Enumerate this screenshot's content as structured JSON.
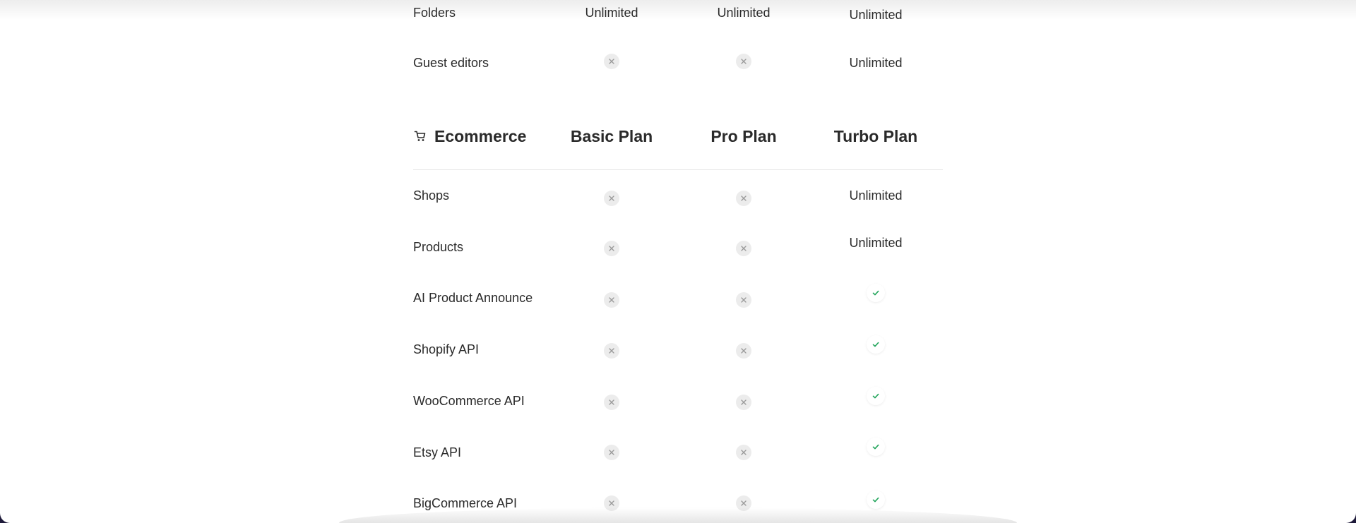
{
  "top_rows": [
    {
      "feature": "Folders",
      "basic": "Unlimited",
      "pro": "Unlimited",
      "turbo": "Unlimited"
    },
    {
      "feature": "Guest editors",
      "basic": "x",
      "pro": "x",
      "turbo": "Unlimited"
    }
  ],
  "ecommerce": {
    "title": "Ecommerce",
    "icon": "shopping-cart-icon",
    "plans": [
      "Basic Plan",
      "Pro Plan",
      "Turbo Plan"
    ],
    "rows": [
      {
        "feature": "Shops",
        "basic": "x",
        "pro": "x",
        "turbo": "Unlimited"
      },
      {
        "feature": "Products",
        "basic": "x",
        "pro": "x",
        "turbo": "Unlimited"
      },
      {
        "feature": "AI Product Announce",
        "basic": "x",
        "pro": "x",
        "turbo": "check"
      },
      {
        "feature": "Shopify API",
        "basic": "x",
        "pro": "x",
        "turbo": "check"
      },
      {
        "feature": "WooCommerce API",
        "basic": "x",
        "pro": "x",
        "turbo": "check"
      },
      {
        "feature": "Etsy API",
        "basic": "x",
        "pro": "x",
        "turbo": "check"
      },
      {
        "feature": "BigCommerce API",
        "basic": "x",
        "pro": "x",
        "turbo": "check"
      }
    ]
  },
  "colors": {
    "check": "#22a55b",
    "x_mark": "#9a9a9a",
    "x_bg": "#ececec",
    "frame": "#1e1a3a"
  }
}
